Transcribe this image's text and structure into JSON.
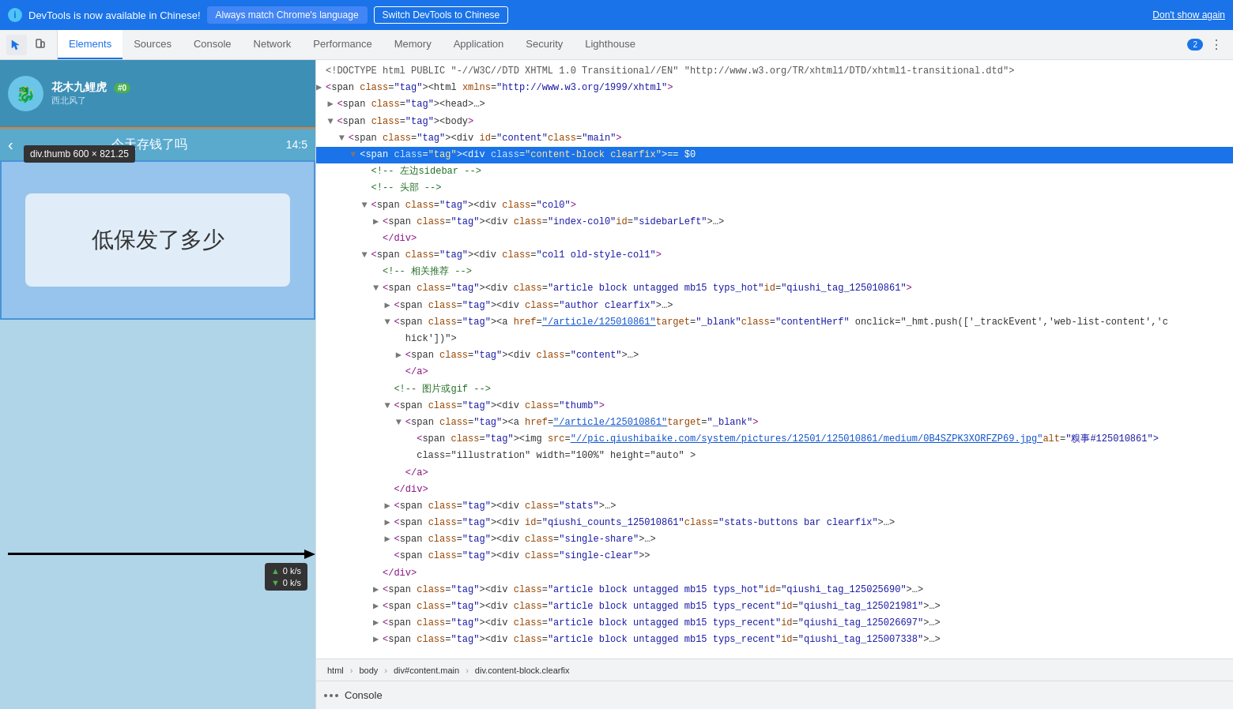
{
  "notif_bar": {
    "info_icon": "i",
    "message": "DevTools is now available in Chinese!",
    "btn_match": "Always match Chrome's language",
    "btn_switch": "Switch DevTools to Chinese",
    "btn_dismiss": "Don't show again"
  },
  "toolbar": {
    "tabs": [
      {
        "label": "Elements",
        "active": true
      },
      {
        "label": "Sources",
        "active": false
      },
      {
        "label": "Console",
        "active": false
      },
      {
        "label": "Network",
        "active": false
      },
      {
        "label": "Performance",
        "active": false
      },
      {
        "label": "Memory",
        "active": false
      },
      {
        "label": "Application",
        "active": false
      },
      {
        "label": "Security",
        "active": false
      },
      {
        "label": "Lighthouse",
        "active": false
      }
    ],
    "badge_count": "2"
  },
  "webpage": {
    "user_name": "花木九鲤虎",
    "badge": "#0",
    "tooltip_element": "div.thumb",
    "tooltip_size": "600 × 821.25",
    "nav_title": "今天存钱了吗",
    "nav_time": "14:5",
    "main_text": "低保发了多少"
  },
  "dom": {
    "lines": [
      {
        "indent": 0,
        "arrow": "",
        "content": "<!DOCTYPE html PUBLIC \"-//W3C//DTD XHTML 1.0 Transitional//EN\" \"http://www.w3.org/TR/xhtml1/DTD/xhtml1-transitional.dtd\">",
        "type": "doctype"
      },
      {
        "indent": 0,
        "arrow": "▶",
        "content": "<html xmlns=\"http://www.w3.org/1999/xhtml\">",
        "type": "tag-open"
      },
      {
        "indent": 1,
        "arrow": "▶",
        "content": "<head>…</head>",
        "type": "tag-closed"
      },
      {
        "indent": 1,
        "arrow": "▼",
        "content": "<body>",
        "type": "tag-open"
      },
      {
        "indent": 2,
        "arrow": "▼",
        "content": "<div id=\"content\" class=\"main\">",
        "type": "tag-open"
      },
      {
        "indent": 3,
        "arrow": "▼",
        "content": "<div class=\"content-block clearfix\"> == $0",
        "type": "tag-selected"
      },
      {
        "indent": 4,
        "arrow": "",
        "content": "<!-- 左边sidebar -->",
        "type": "comment"
      },
      {
        "indent": 4,
        "arrow": "",
        "content": "<!-- 头部 -->",
        "type": "comment"
      },
      {
        "indent": 4,
        "arrow": "▼",
        "content": "<div class=\"col0\">",
        "type": "tag-open"
      },
      {
        "indent": 5,
        "arrow": "▶",
        "content": "<div class=\"index-col0\" id=\"sidebarLeft\">…</div>",
        "type": "tag-closed"
      },
      {
        "indent": 5,
        "arrow": "",
        "content": "</div>",
        "type": "close"
      },
      {
        "indent": 4,
        "arrow": "▼",
        "content": "<div class=\"col1 old-style-col1\">",
        "type": "tag-open"
      },
      {
        "indent": 5,
        "arrow": "",
        "content": "<!-- 相关推荐 -->",
        "type": "comment"
      },
      {
        "indent": 5,
        "arrow": "▼",
        "content": "<div class=\"article block untagged mb15 typs_hot\" id=\"qiushi_tag_125010861\">",
        "type": "tag-open"
      },
      {
        "indent": 6,
        "arrow": "▶",
        "content": "<div class=\"author clearfix\">…</div>",
        "type": "tag-closed"
      },
      {
        "indent": 6,
        "arrow": "▼",
        "content": "<a href=\"/article/125010861\" target=\"_blank\" class=\"contentHerf\" onclick=\"_hmt.push(['_trackEvent','web-list-content','c",
        "type": "tag-open"
      },
      {
        "indent": 7,
        "arrow": "",
        "content": "hick'])\">",
        "type": "continuation"
      },
      {
        "indent": 7,
        "arrow": "▶",
        "content": "<div class=\"content\">…</div>",
        "type": "tag-closed"
      },
      {
        "indent": 7,
        "arrow": "",
        "content": "</a>",
        "type": "close"
      },
      {
        "indent": 6,
        "arrow": "",
        "content": "<!-- 图片或gif -->",
        "type": "comment"
      },
      {
        "indent": 6,
        "arrow": "▼",
        "content": "<div class=\"thumb\">",
        "type": "tag-open-highlight"
      },
      {
        "indent": 7,
        "arrow": "▼",
        "content": "<a href=\"/article/125010861\" target=\"_blank\">",
        "type": "tag-open"
      },
      {
        "indent": 8,
        "arrow": "",
        "content": "<img src=\"//pic.qiushibaike.com/system/pictures/12501/125010861/medium/0B4SZPK3XORFZP69.jpg\" alt=\"糗事#125010861\"",
        "type": "img-tag"
      },
      {
        "indent": 8,
        "arrow": "",
        "content": "class=\"illustration\" width=\"100%\" height=\"auto\" >",
        "type": "continuation"
      },
      {
        "indent": 7,
        "arrow": "",
        "content": "</a>",
        "type": "close"
      },
      {
        "indent": 6,
        "arrow": "",
        "content": "</div>",
        "type": "close"
      },
      {
        "indent": 6,
        "arrow": "▶",
        "content": "<div class=\"stats\">…</div>",
        "type": "tag-closed"
      },
      {
        "indent": 6,
        "arrow": "▶",
        "content": "<div id=\"qiushi_counts_125010861\" class=\"stats-buttons bar clearfix\">…</div>",
        "type": "tag-closed"
      },
      {
        "indent": 6,
        "arrow": "▶",
        "content": "<div class=\"single-share\">…</div>",
        "type": "tag-closed"
      },
      {
        "indent": 6,
        "arrow": "",
        "content": "<div class=\"single-clear\"></div>",
        "type": "tag-self"
      },
      {
        "indent": 5,
        "arrow": "",
        "content": "</div>",
        "type": "close"
      },
      {
        "indent": 5,
        "arrow": "▶",
        "content": "<div class=\"article block untagged mb15 typs_hot\" id=\"qiushi_tag_125025690\">…</div>",
        "type": "tag-closed"
      },
      {
        "indent": 5,
        "arrow": "▶",
        "content": "<div class=\"article block untagged mb15 typs_recent\" id=\"qiushi_tag_125021981\">…</div>",
        "type": "tag-closed"
      },
      {
        "indent": 5,
        "arrow": "▶",
        "content": "<div class=\"article block untagged mb15 typs_recent\" id=\"qiushi_tag_125026697\">…</div>",
        "type": "tag-closed"
      },
      {
        "indent": 5,
        "arrow": "▶",
        "content": "<div class=\"article block untagged mb15 typs_recent\" id=\"qiushi_tag_125007338\">…</div>",
        "type": "tag-closed"
      }
    ]
  },
  "breadcrumb": {
    "items": [
      "html",
      "body",
      "div#content.main",
      "div.content-block.clearfix"
    ]
  },
  "console": {
    "label": "Console"
  },
  "speed": {
    "up": "0 k/s",
    "down": "0 k/s"
  }
}
